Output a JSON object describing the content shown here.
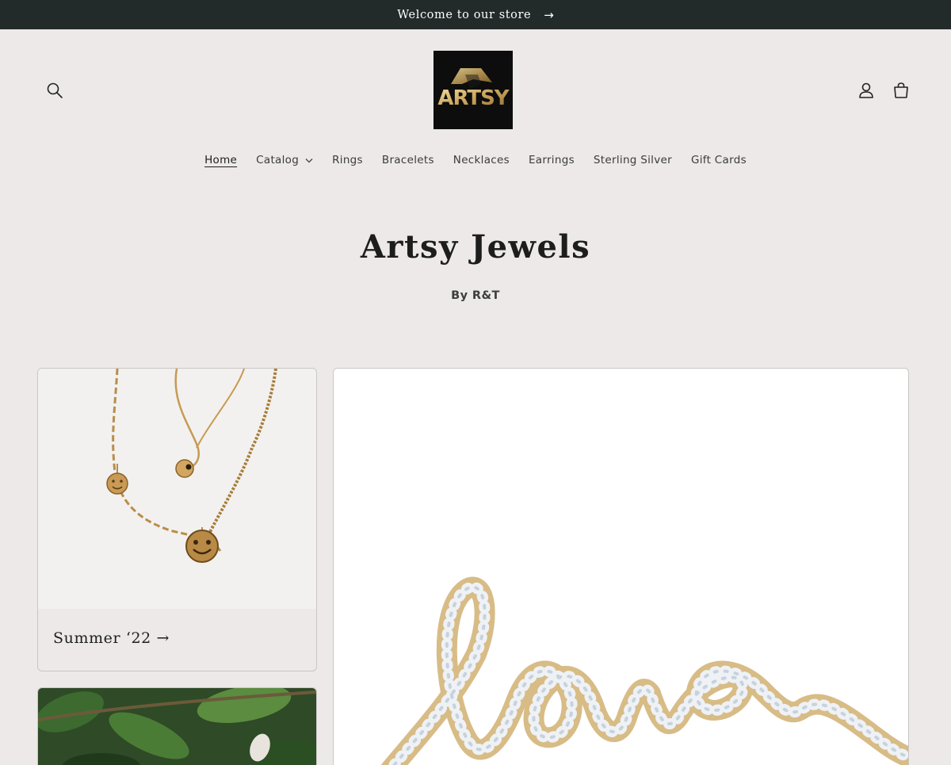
{
  "announcement": {
    "text": "Welcome to our store",
    "arrow": "→"
  },
  "header": {
    "logo_text": "ARTSY",
    "icons": [
      "search-icon",
      "account-icon",
      "cart-icon"
    ]
  },
  "nav": {
    "items": [
      {
        "label": "Home",
        "active": true
      },
      {
        "label": "Catalog",
        "has_dropdown": true
      },
      {
        "label": "Rings"
      },
      {
        "label": "Bracelets"
      },
      {
        "label": "Necklaces"
      },
      {
        "label": "Earrings"
      },
      {
        "label": "Sterling Silver"
      },
      {
        "label": "Gift Cards"
      }
    ]
  },
  "hero": {
    "title": "Artsy Jewels",
    "subtitle": "By R&T"
  },
  "collections": [
    {
      "caption": "Summer ‘22",
      "arrow": "→"
    }
  ],
  "colors": {
    "announcement_bg": "#232a2a",
    "page_bg": "#ece9e8",
    "gold": "#c9a45c"
  }
}
